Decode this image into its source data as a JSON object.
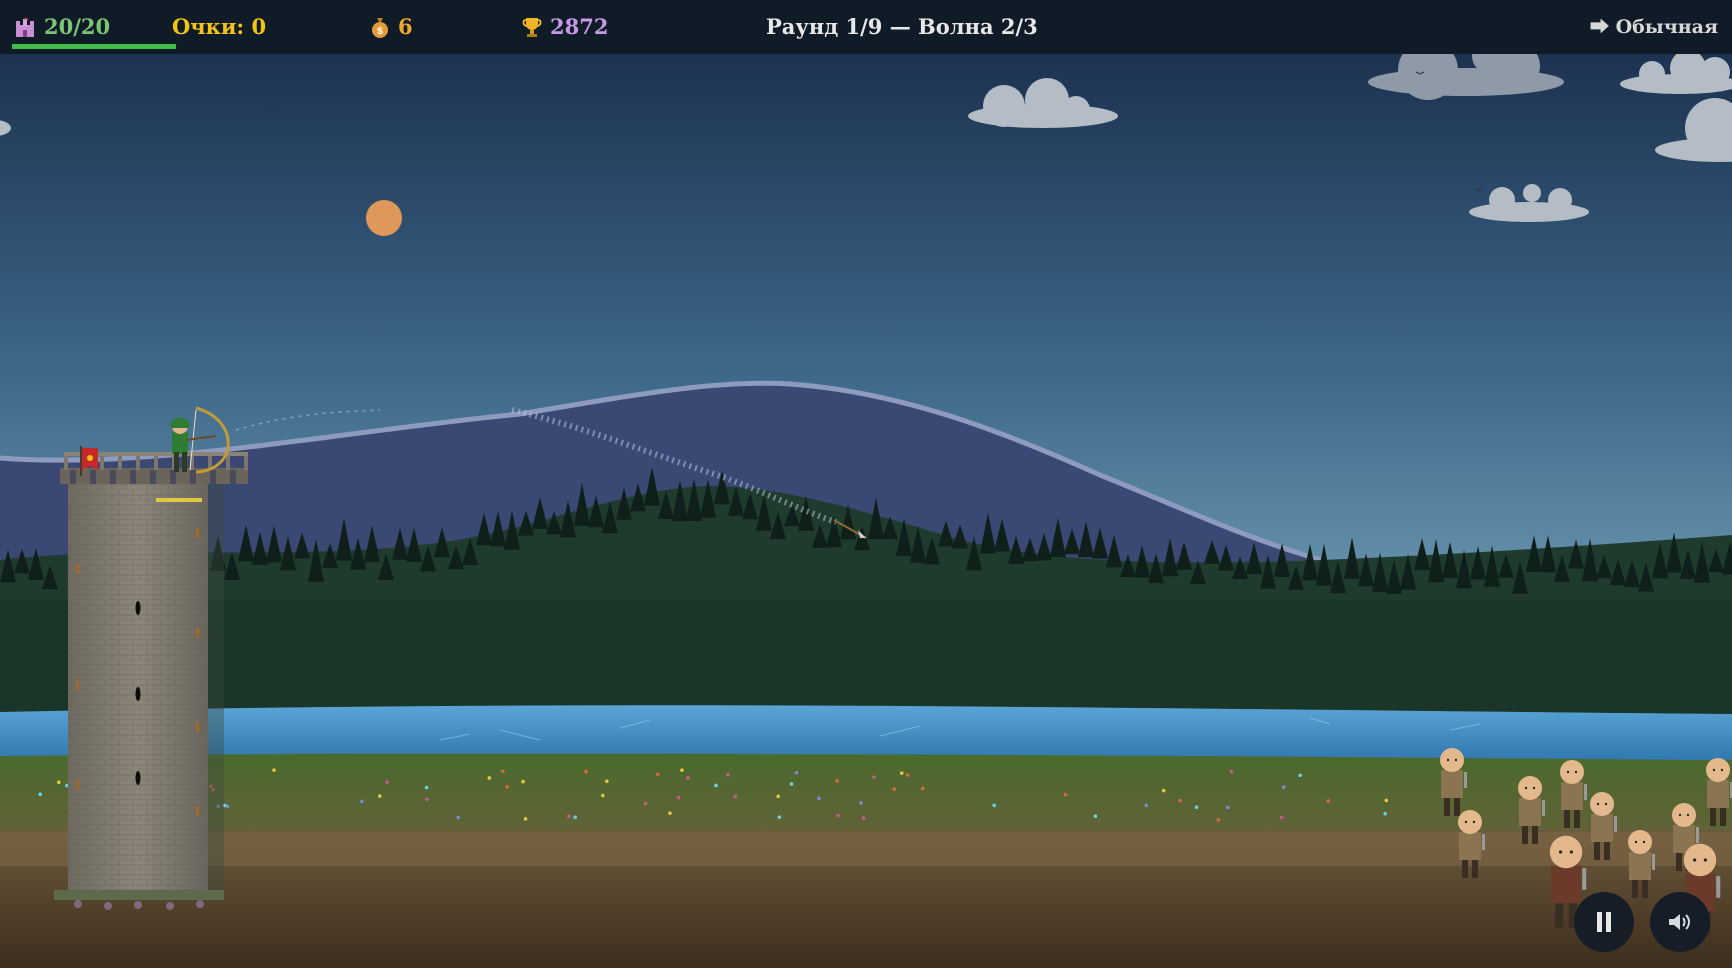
{
  "hud": {
    "health": "20/20",
    "health_fraction": 1.0,
    "score_label": "Очки: 0",
    "gold": "6",
    "trophy": "2872",
    "round_wave": "Раунд 1/9 — Волна 2/3",
    "difficulty": "⮕ Обычная"
  },
  "icons": {
    "health": "castle-icon",
    "gold": "money-bag-icon",
    "trophy": "trophy-icon",
    "pause": "pause-icon",
    "sound": "speaker-icon"
  },
  "colors": {
    "health": "#7cc576",
    "health_bar": "#3fbf4a",
    "score": "#f3c316",
    "gold": "#f0a92e",
    "trophy": "#c69ae6",
    "round": "#e8e8e8",
    "archer": "#2e7d32",
    "banner": "#c62828"
  },
  "scene": {
    "enemy_count": 10
  }
}
